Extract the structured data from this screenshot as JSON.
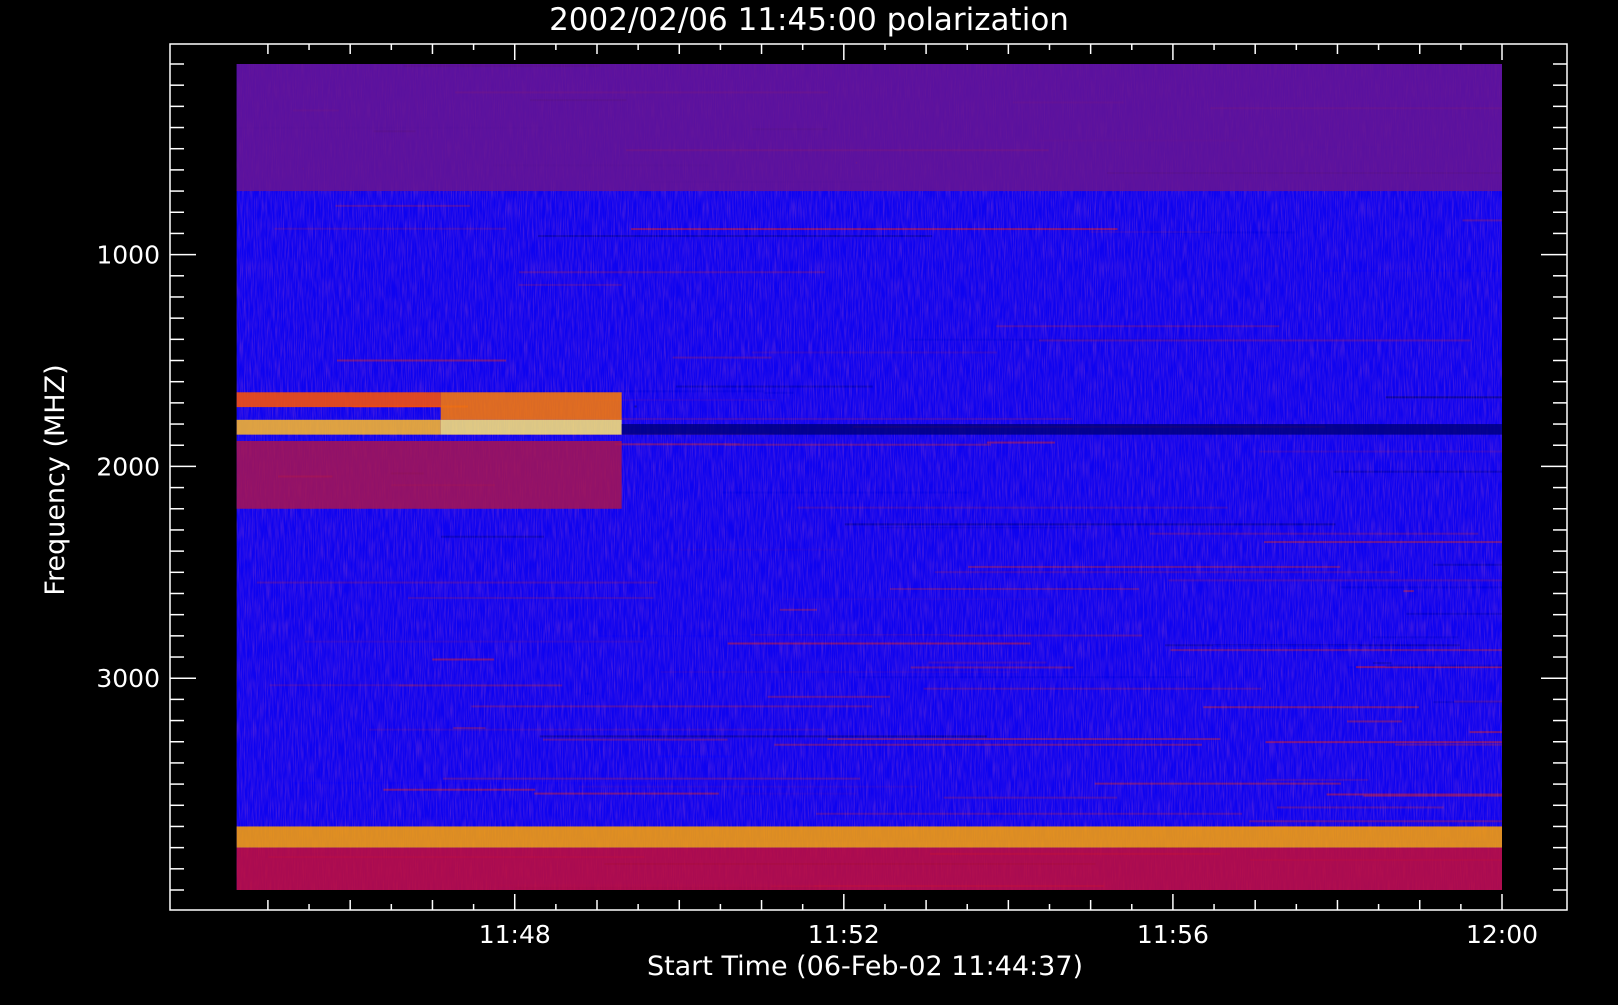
{
  "chart_data": {
    "type": "heatmap",
    "title": "2002/02/06 11:45:00 polarization",
    "xlabel": "Start Time (06-Feb-02 11:44:37)",
    "ylabel": "Frequency (MHZ)",
    "x_ticks": [
      "11:48",
      "11:52",
      "11:56",
      "12:00"
    ],
    "y_ticks": [
      "1000",
      "2000",
      "3000"
    ],
    "x_range_minutes": [
      44.6,
      60.0
    ],
    "x_tick_minutes": [
      48,
      52,
      56,
      60
    ],
    "y_range_mhz": [
      100,
      4000
    ],
    "y_tick_mhz": [
      1000,
      2000,
      3000
    ],
    "y_axis_inverted": true,
    "colormap": [
      "#000000",
      "#0000ff",
      "#8b1a6a",
      "#ff0000",
      "#ffa500",
      "#ffff99"
    ],
    "background_color": "#000000",
    "axis_color": "#ffffff",
    "data_start_minute": 44.62,
    "data_end_minute": 60.0,
    "features": [
      {
        "kind": "band",
        "t": [
          44.62,
          47.1
        ],
        "f": [
          1650,
          1720
        ],
        "level": 0.7
      },
      {
        "kind": "band",
        "t": [
          44.62,
          47.1
        ],
        "f": [
          1780,
          1850
        ],
        "level": 0.85
      },
      {
        "kind": "band",
        "t": [
          47.1,
          49.3
        ],
        "f": [
          1650,
          1780
        ],
        "level": 0.75
      },
      {
        "kind": "band",
        "t": [
          47.1,
          49.3
        ],
        "f": [
          1780,
          1850
        ],
        "level": 0.95
      },
      {
        "kind": "band",
        "t": [
          44.62,
          49.3
        ],
        "f": [
          1880,
          2200
        ],
        "level": 0.45
      },
      {
        "kind": "band",
        "t": [
          44.62,
          60.0
        ],
        "f": [
          3700,
          3800
        ],
        "level": 0.8
      },
      {
        "kind": "band",
        "t": [
          44.62,
          60.0
        ],
        "f": [
          3800,
          4000
        ],
        "level": 0.5
      },
      {
        "kind": "band",
        "t": [
          49.3,
          60.0
        ],
        "f": [
          1800,
          1850
        ],
        "level": 0.1
      },
      {
        "kind": "band",
        "t": [
          44.62,
          60.0
        ],
        "f": [
          100,
          700
        ],
        "level": 0.35
      }
    ]
  }
}
